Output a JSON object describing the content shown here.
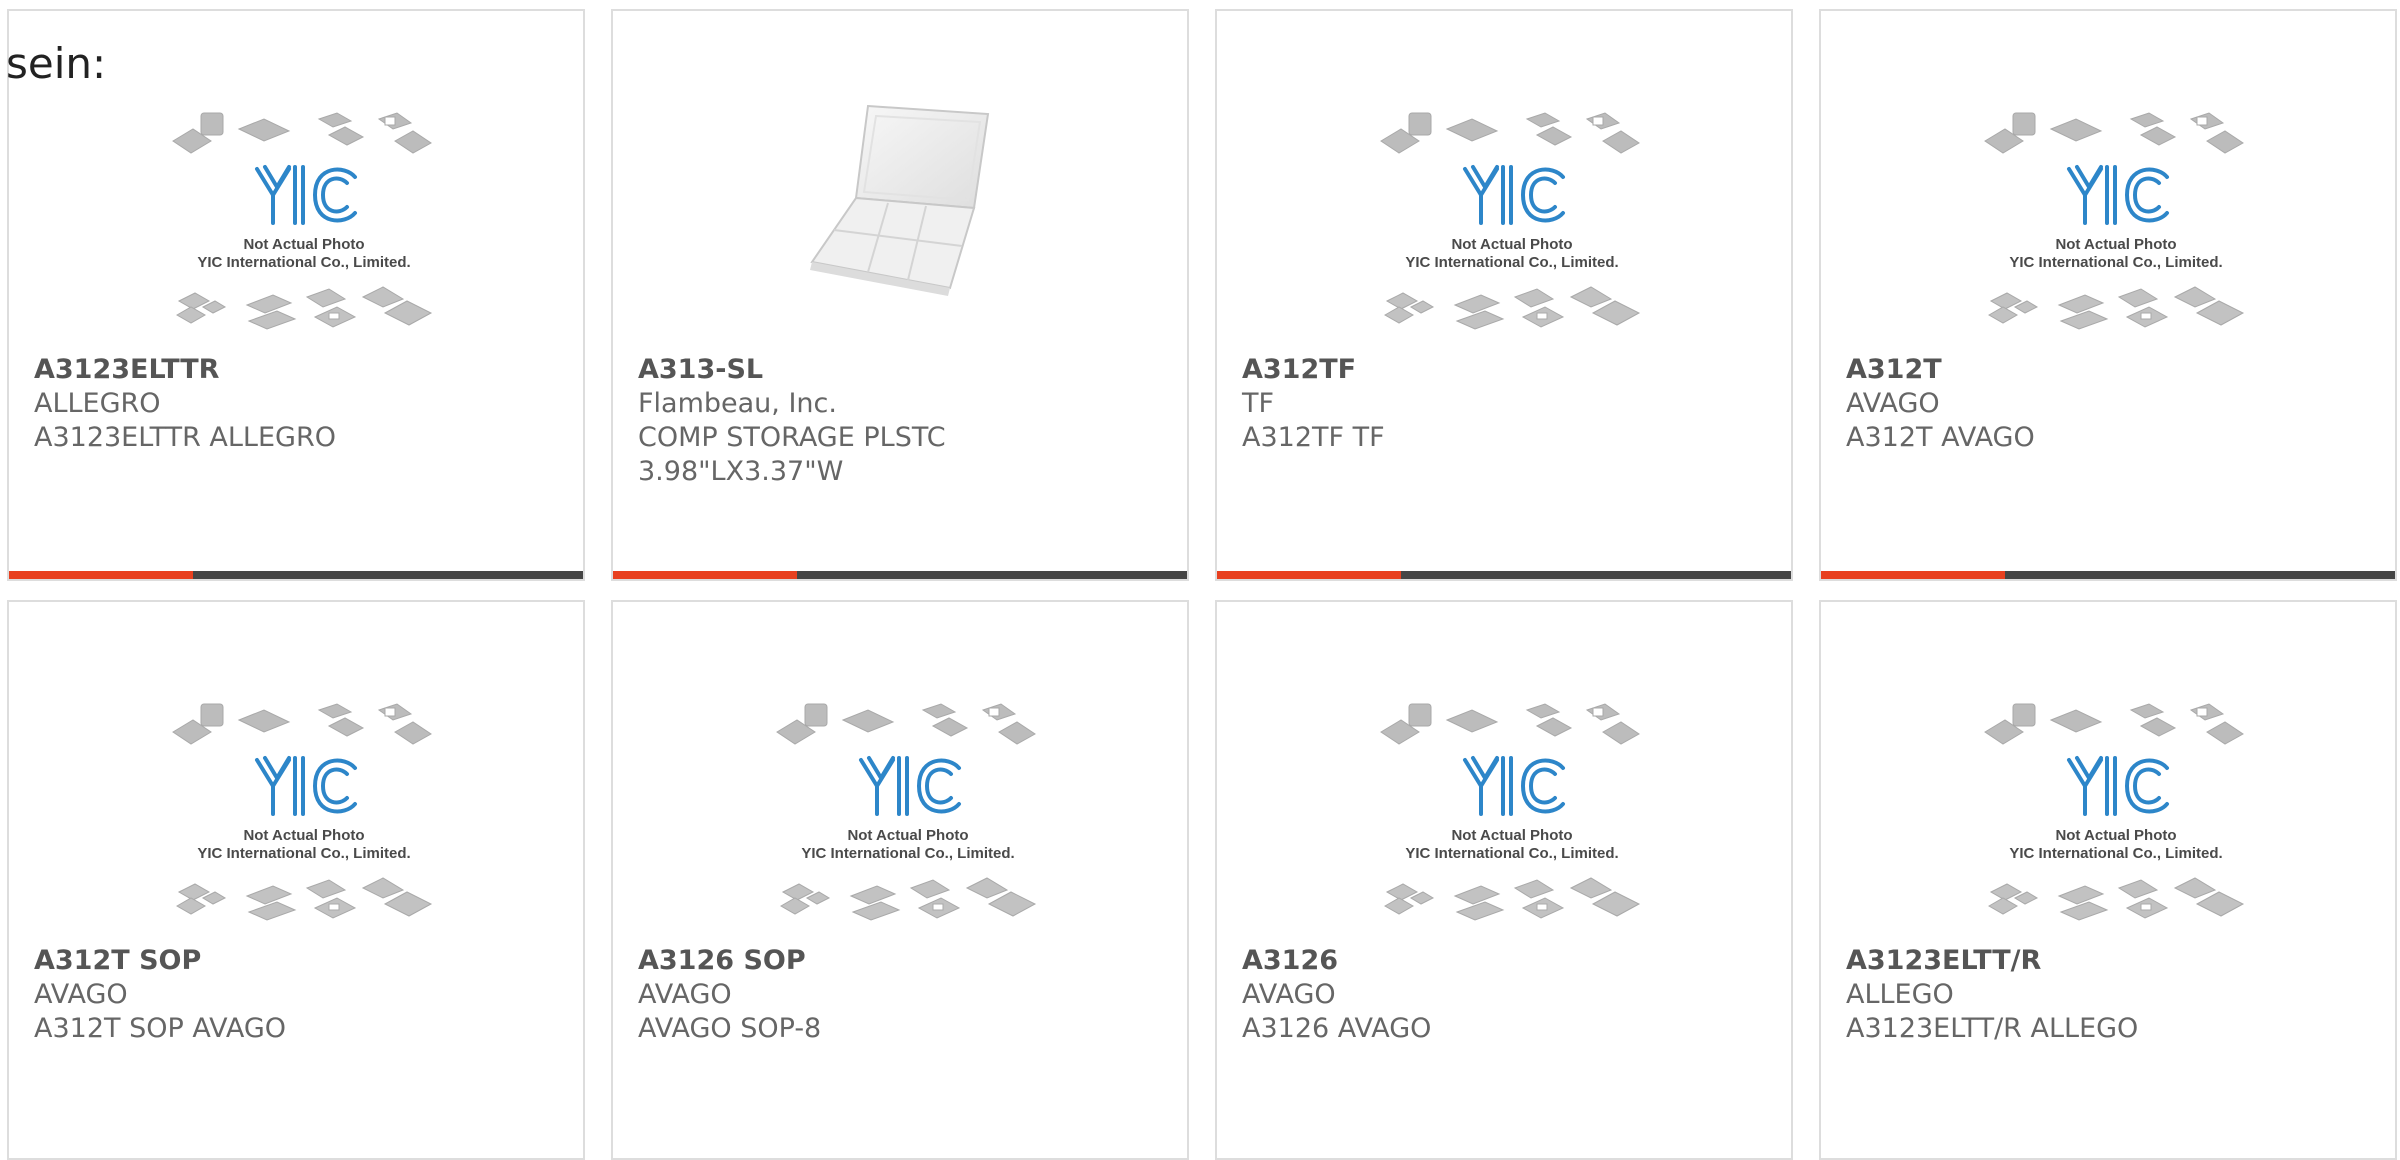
{
  "intro": "sein:",
  "colors": {
    "progress_fill": "#e8401f",
    "progress_track": "#454545",
    "logo_blue": "#2d86c9",
    "chip_gray": "#bcbcbc"
  },
  "placeholder": {
    "caption_line1": "Not Actual Photo",
    "caption_line2": "YIC International Co., Limited.",
    "logo_text": "YIC"
  },
  "cards": [
    {
      "title": "A3123ELTTR",
      "line1": "ALLEGRO",
      "line2": "A3123ELTTR ALLEGRO",
      "image": "placeholder",
      "progress": 0.32
    },
    {
      "title": "A313-SL",
      "line1": "Flambeau, Inc.",
      "line2": "COMP STORAGE PLSTC 3.98\"LX3.37\"W",
      "image": "storage-box",
      "progress": 0.32
    },
    {
      "title": "A312TF",
      "line1": "TF",
      "line2": "A312TF TF",
      "image": "placeholder",
      "progress": 0.32
    },
    {
      "title": "A312T",
      "line1": "AVAGO",
      "line2": "A312T AVAGO",
      "image": "placeholder",
      "progress": 0.32
    },
    {
      "title": "A312T SOP",
      "line1": "AVAGO",
      "line2": "A312T SOP AVAGO",
      "image": "placeholder"
    },
    {
      "title": "A3126 SOP",
      "line1": "AVAGO",
      "line2": "AVAGO SOP-8",
      "image": "placeholder"
    },
    {
      "title": "A3126",
      "line1": "AVAGO",
      "line2": "A3126 AVAGO",
      "image": "placeholder"
    },
    {
      "title": "A3123ELTT/R",
      "line1": "ALLEGO",
      "line2": "A3123ELTT/R ALLEGO",
      "image": "placeholder"
    }
  ]
}
